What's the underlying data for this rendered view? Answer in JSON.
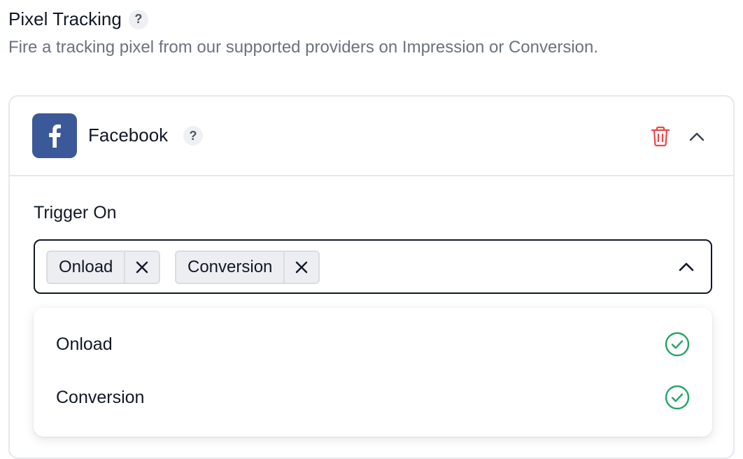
{
  "section": {
    "title": "Pixel Tracking",
    "help": "?",
    "description": "Fire a tracking pixel from our supported providers on Impression or Conversion."
  },
  "provider": {
    "name": "Facebook",
    "logo_letter": "f",
    "help": "?",
    "brand_color": "#3b5998",
    "delete_color": "#ef4444"
  },
  "trigger": {
    "label": "Trigger On",
    "selected": [
      "Onload",
      "Conversion"
    ],
    "options": [
      {
        "label": "Onload",
        "selected": true
      },
      {
        "label": "Conversion",
        "selected": true
      }
    ],
    "check_color": "#22a565"
  }
}
